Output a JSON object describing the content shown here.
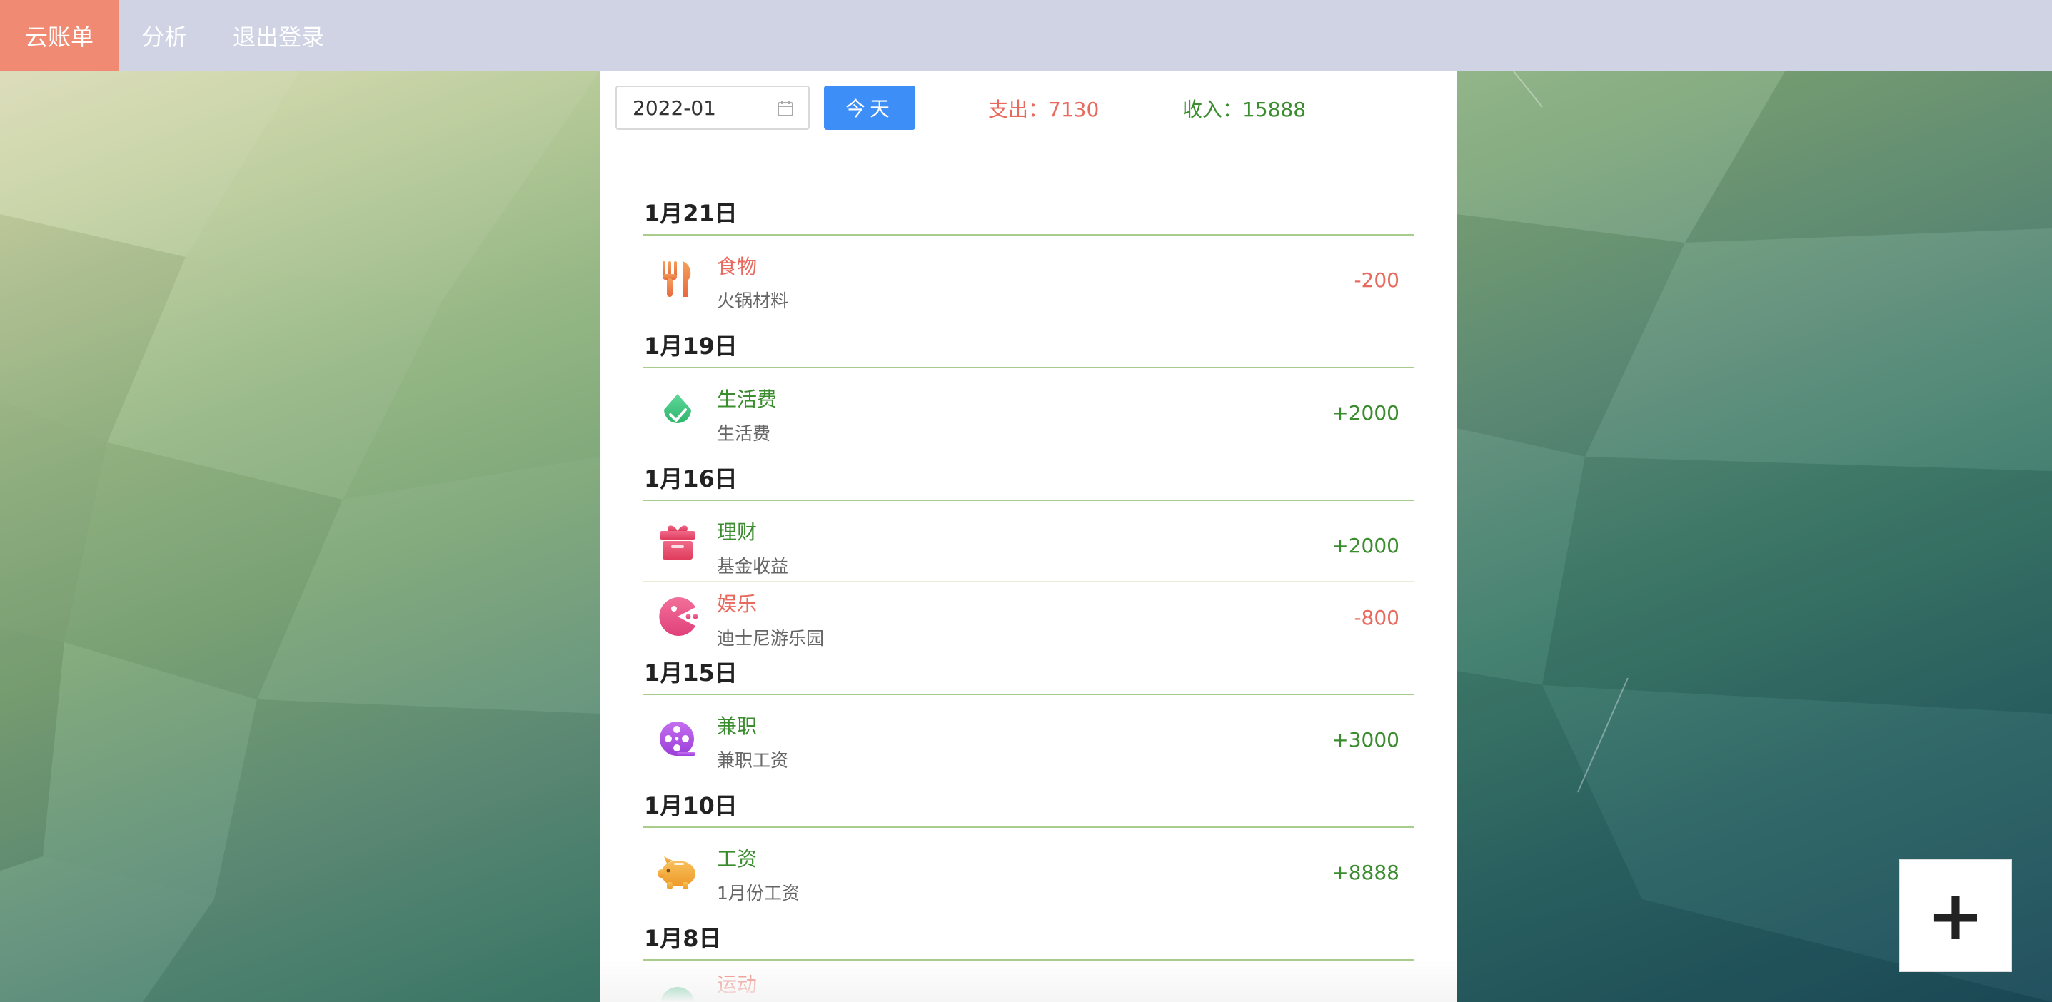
{
  "nav": {
    "items": [
      {
        "label": "云账单",
        "active": true
      },
      {
        "label": "分析",
        "active": false
      },
      {
        "label": "退出登录",
        "active": false
      }
    ]
  },
  "toolbar": {
    "month_value": "2022-01",
    "today_label": "今天",
    "expense_text": "支出：7130",
    "income_text": "收入：15888"
  },
  "days": [
    {
      "date": "1月21日",
      "records": [
        {
          "category": "食物",
          "note": "火锅材料",
          "amount": "-200",
          "type": "expense",
          "icon": "fork-knife-icon"
        }
      ]
    },
    {
      "date": "1月19日",
      "records": [
        {
          "category": "生活费",
          "note": "生活费",
          "amount": "+2000",
          "type": "income",
          "icon": "water-drop-check-icon"
        }
      ]
    },
    {
      "date": "1月16日",
      "records": [
        {
          "category": "理财",
          "note": "基金收益",
          "amount": "+2000",
          "type": "income",
          "icon": "gift-box-icon"
        },
        {
          "category": "娱乐",
          "note": "迪士尼游乐园",
          "amount": "-800",
          "type": "expense",
          "icon": "pacman-icon"
        }
      ]
    },
    {
      "date": "1月15日",
      "records": [
        {
          "category": "兼职",
          "note": "兼职工资",
          "amount": "+3000",
          "type": "income",
          "icon": "film-reel-icon"
        }
      ]
    },
    {
      "date": "1月10日",
      "records": [
        {
          "category": "工资",
          "note": "1月份工资",
          "amount": "+8888",
          "type": "income",
          "icon": "piggy-bank-icon"
        }
      ]
    },
    {
      "date": "1月8日",
      "records": [
        {
          "category": "运动",
          "note": "",
          "amount": "",
          "type": "expense",
          "icon": "sport-icon"
        }
      ]
    }
  ],
  "fab": {
    "label": "+"
  },
  "colors": {
    "nav_bg": "#cfd3e4",
    "nav_active": "#f08a72",
    "primary": "#3e8ef7",
    "expense": "#e86a5e",
    "income": "#3a8c2e"
  }
}
